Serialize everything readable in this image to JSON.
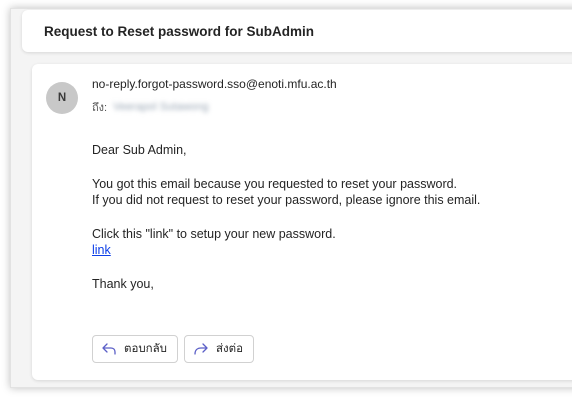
{
  "email": {
    "subject": "Request to Reset password for SubAdmin",
    "sender_initial": "N",
    "sender_address": "no-reply.forgot-password.sso@enoti.mfu.ac.th",
    "to_label": "ถึง:",
    "to_recipient": "Veerapol Sutawong",
    "greeting": "Dear Sub Admin,",
    "line1": "You got this email because you requested to reset your password.",
    "line2": "If you did not request to reset your password, please ignore this email.",
    "line3": "Click this \"link\" to setup your new password.",
    "link_text": "link",
    "closing": "Thank you,"
  },
  "actions": {
    "reply_label": "ตอบกลับ",
    "forward_label": "ส่งต่อ"
  },
  "colors": {
    "accent": "#5b5fc7",
    "link": "#0b3ee8"
  },
  "icons": {
    "reply": "reply-arrow-icon",
    "forward": "forward-arrow-icon"
  }
}
